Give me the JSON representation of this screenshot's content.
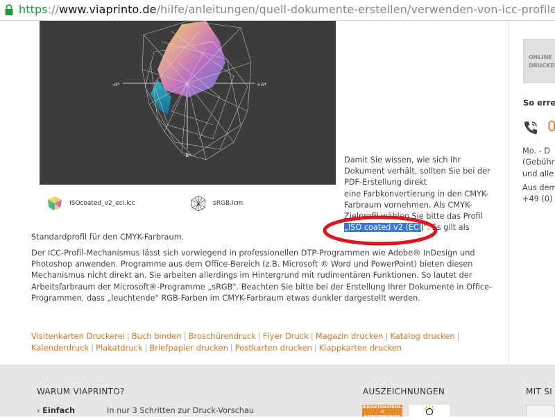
{
  "url": {
    "scheme": "https",
    "separator": "://",
    "domain": "www.viaprinto.de",
    "path": "/hilfe/anleitungen/quell-dokumente-erstellen/verwenden-von-icc-profilen"
  },
  "gamut_image": {
    "label_minus_a": "-A*",
    "label_plus_a": "+A*",
    "label_minus_b": "-B*"
  },
  "files": [
    {
      "name": "ISOcoated_v2_eci.icc",
      "icon": "icc-profile-icon"
    },
    {
      "name": "sRGB.icm",
      "icon": "icm-profile-icon"
    }
  ],
  "intro": {
    "line1": "Damit Sie wissen, wie sich Ihr",
    "line2": "Dokument verhält, sollten Sie bei der",
    "line3": "PDF-Erstellung direkt",
    "line4": "eine Farbkonvertierung in den CMYK-",
    "line5": "Farbraum vornehmen. Als CMYK-",
    "line6": "Zielprofil wählen Sie bitte das Profil",
    "highlight": "„ISO coated v2 (ECI",
    "line7_rest": "\". Es gilt als"
  },
  "para1": "Standardprofil für den CMYK-Farbraum.",
  "para2": "Der ICC-Profil-Mechanismus lässt sich vorwiegend in professionellen DTP-Programmen wie Adobe® InDesign und Photoshop anwenden. Programme aus dem Office-Bereich (z.B. Microsoft ® Word und PowerPoint) bieten diesen Mechanismus nicht direkt an. Sie arbeiten allerdings im Hintergrund mit rudimentären Funktionen. So lautet der Arbeitsfarbraum der Microsoft®-Programme „sRGB\". Beachten Sie bitte bei der Erstellung Ihrer Dokumente in Office-Programmen, dass „leuchtende\" RGB-Farben im CMYK-Farbraum etwas dunkler dargestellt werden.",
  "links": [
    "Visitenkarten Druckerei",
    "Buch binden",
    "Broschürendruck",
    "Flyer Druck",
    "Magazin drucken",
    "Katalog drucken",
    "Kalenderdruck",
    "Plakatdruck",
    "Briefpapier drucken",
    "Postkarten drucken",
    "Klappkarten drucken"
  ],
  "link_separator": "|",
  "sidebar": {
    "banner_line1": "ONLINE",
    "banner_line2": "DRUCKER",
    "heading": "So erre",
    "phone": "0",
    "hours_line1": "Mo. - D",
    "hours_line2": "(Gebühr",
    "hours_line3": "und alle",
    "abroad_line1": "Aus dem",
    "abroad_line2": "+49 (0)"
  },
  "footer": {
    "why_title": "WARUM VIAPRINTO?",
    "awards_title": "AUSZEICHNUNGEN",
    "third_title": "MIT SI",
    "item_label": "Einfach",
    "item_desc": "In nur 3 Schritten zur Druck-Vorschau",
    "award1_line1": "INNOVATIONSPREIS-IT",
    "award1_line2": "KATEGORIESIEGER"
  },
  "colors": {
    "link": "#e07420",
    "highlight": "#3b78d6",
    "ellipse": "#e0141e",
    "scheme": "#1d9a3a"
  }
}
